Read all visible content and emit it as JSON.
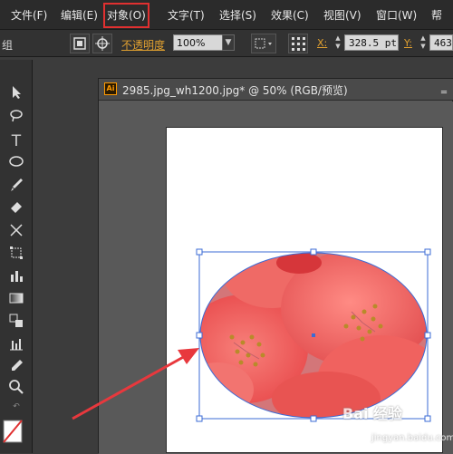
{
  "menubar": {
    "items": [
      {
        "label": "文件(F)"
      },
      {
        "label": "编辑(E)"
      },
      {
        "label": "对象(O)",
        "highlighted": true
      },
      {
        "label": "文字(T)"
      },
      {
        "label": "选择(S)"
      },
      {
        "label": "效果(C)"
      },
      {
        "label": "视图(V)"
      },
      {
        "label": "窗口(W)"
      },
      {
        "label": "帮"
      }
    ],
    "highlight_color": "#e03030"
  },
  "options": {
    "group_label": "组",
    "opacity_label": "不透明度",
    "opacity_value": "100%",
    "x_label": "X:",
    "x_value": "328.5 pt",
    "y_label": "Y:",
    "y_value": "463"
  },
  "document": {
    "title": "2985.jpg_wh1200.jpg* @ 50% (RGB/预览)",
    "app_icon": "Ai"
  },
  "tools": [
    "selection-arrow-icon",
    "lasso-icon",
    "type-icon",
    "ellipse-icon",
    "brush-icon",
    "eraser-icon",
    "scissors-icon",
    "free-transform-icon",
    "column-graph-icon",
    "gradient-icon",
    "blend-icon",
    "bar-chart-icon",
    "eyedropper-icon",
    "zoom-icon",
    "fill-stroke-icon"
  ],
  "watermark": {
    "text": "Bai 经验",
    "sub": "jingyan.baidu.com"
  },
  "colors": {
    "selection": "#3b6bd6",
    "arrow": "#e8383d",
    "flower": "#f05a5a"
  }
}
